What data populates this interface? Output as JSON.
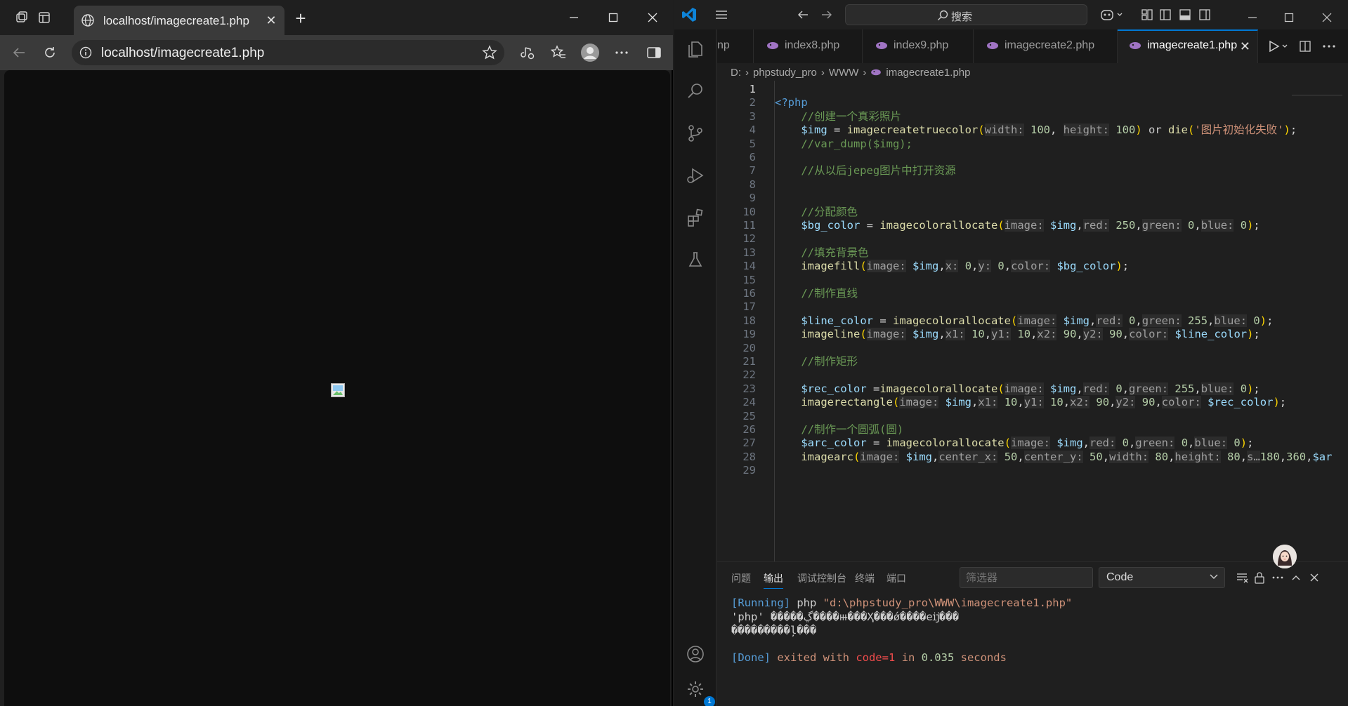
{
  "browser": {
    "tab_title": "localhost/imagecreate1.php",
    "url": "localhost/imagecreate1.php"
  },
  "vscode": {
    "search_label": "搜索",
    "tabs": [
      {
        "label": "np"
      },
      {
        "label": "index8.php"
      },
      {
        "label": "index9.php"
      },
      {
        "label": "imagecreate2.php"
      },
      {
        "label": "imagecreate1.php",
        "active": true
      }
    ],
    "breadcrumb": [
      "D:",
      "phpstudy_pro",
      "WWW",
      "imagecreate1.php"
    ],
    "code_lines": [
      {
        "n": "1",
        "tokens": []
      },
      {
        "n": "2",
        "tokens": [
          [
            "tag",
            "<?php"
          ]
        ]
      },
      {
        "n": "3",
        "tokens": [
          [
            "sp",
            "    "
          ],
          [
            "cm",
            "//创建一个真彩照片"
          ]
        ]
      },
      {
        "n": "4",
        "tokens": [
          [
            "sp",
            "    "
          ],
          [
            "var",
            "$img"
          ],
          [
            "op",
            " = "
          ],
          [
            "fn",
            "imagecreatetruecolor"
          ],
          [
            "par",
            "("
          ],
          [
            "hint",
            "width:"
          ],
          [
            "op",
            " "
          ],
          [
            "num",
            "100"
          ],
          [
            "op",
            ", "
          ],
          [
            "hint",
            "height:"
          ],
          [
            "op",
            " "
          ],
          [
            "num",
            "100"
          ],
          [
            "par",
            ")"
          ],
          [
            "kw",
            " or "
          ],
          [
            "fn",
            "die"
          ],
          [
            "par",
            "("
          ],
          [
            "str",
            "'图片初始化失败'"
          ],
          [
            "par",
            ")"
          ],
          [
            "op",
            ";"
          ]
        ]
      },
      {
        "n": "5",
        "tokens": [
          [
            "sp",
            "    "
          ],
          [
            "cm",
            "//var_dump($img);"
          ]
        ]
      },
      {
        "n": "6",
        "tokens": []
      },
      {
        "n": "7",
        "tokens": [
          [
            "sp",
            "    "
          ],
          [
            "cm",
            "//从以后jepeg图片中打开资源"
          ]
        ]
      },
      {
        "n": "8",
        "tokens": []
      },
      {
        "n": "9",
        "tokens": []
      },
      {
        "n": "10",
        "tokens": [
          [
            "sp",
            "    "
          ],
          [
            "cm",
            "//分配颜色"
          ]
        ]
      },
      {
        "n": "11",
        "tokens": [
          [
            "sp",
            "    "
          ],
          [
            "var",
            "$bg_color"
          ],
          [
            "op",
            " = "
          ],
          [
            "fn",
            "imagecolorallocate"
          ],
          [
            "par",
            "("
          ],
          [
            "hint",
            "image:"
          ],
          [
            "op",
            " "
          ],
          [
            "var",
            "$img"
          ],
          [
            "op",
            ","
          ],
          [
            "hint",
            "red:"
          ],
          [
            "op",
            " "
          ],
          [
            "num",
            "250"
          ],
          [
            "op",
            ","
          ],
          [
            "hint",
            "green:"
          ],
          [
            "op",
            " "
          ],
          [
            "num",
            "0"
          ],
          [
            "op",
            ","
          ],
          [
            "hint",
            "blue:"
          ],
          [
            "op",
            " "
          ],
          [
            "num",
            "0"
          ],
          [
            "par",
            ")"
          ],
          [
            "op",
            ";"
          ]
        ]
      },
      {
        "n": "12",
        "tokens": []
      },
      {
        "n": "13",
        "tokens": [
          [
            "sp",
            "    "
          ],
          [
            "cm",
            "//填充背景色"
          ]
        ]
      },
      {
        "n": "14",
        "tokens": [
          [
            "sp",
            "    "
          ],
          [
            "fn",
            "imagefill"
          ],
          [
            "par",
            "("
          ],
          [
            "hint",
            "image:"
          ],
          [
            "op",
            " "
          ],
          [
            "var",
            "$img"
          ],
          [
            "op",
            ","
          ],
          [
            "hint",
            "x:"
          ],
          [
            "op",
            " "
          ],
          [
            "num",
            "0"
          ],
          [
            "op",
            ","
          ],
          [
            "hint",
            "y:"
          ],
          [
            "op",
            " "
          ],
          [
            "num",
            "0"
          ],
          [
            "op",
            ","
          ],
          [
            "hint",
            "color:"
          ],
          [
            "op",
            " "
          ],
          [
            "var",
            "$bg_color"
          ],
          [
            "par",
            ")"
          ],
          [
            "op",
            ";"
          ]
        ]
      },
      {
        "n": "15",
        "tokens": []
      },
      {
        "n": "16",
        "tokens": [
          [
            "sp",
            "    "
          ],
          [
            "cm",
            "//制作直线"
          ]
        ]
      },
      {
        "n": "17",
        "tokens": []
      },
      {
        "n": "18",
        "tokens": [
          [
            "sp",
            "    "
          ],
          [
            "var",
            "$line_color"
          ],
          [
            "op",
            " = "
          ],
          [
            "fn",
            "imagecolorallocate"
          ],
          [
            "par",
            "("
          ],
          [
            "hint",
            "image:"
          ],
          [
            "op",
            " "
          ],
          [
            "var",
            "$img"
          ],
          [
            "op",
            ","
          ],
          [
            "hint",
            "red:"
          ],
          [
            "op",
            " "
          ],
          [
            "num",
            "0"
          ],
          [
            "op",
            ","
          ],
          [
            "hint",
            "green:"
          ],
          [
            "op",
            " "
          ],
          [
            "num",
            "255"
          ],
          [
            "op",
            ","
          ],
          [
            "hint",
            "blue:"
          ],
          [
            "op",
            " "
          ],
          [
            "num",
            "0"
          ],
          [
            "par",
            ")"
          ],
          [
            "op",
            ";"
          ]
        ]
      },
      {
        "n": "19",
        "tokens": [
          [
            "sp",
            "    "
          ],
          [
            "fn",
            "imageline"
          ],
          [
            "par",
            "("
          ],
          [
            "hint",
            "image:"
          ],
          [
            "op",
            " "
          ],
          [
            "var",
            "$img"
          ],
          [
            "op",
            ","
          ],
          [
            "hint",
            "x1:"
          ],
          [
            "op",
            " "
          ],
          [
            "num",
            "10"
          ],
          [
            "op",
            ","
          ],
          [
            "hint",
            "y1:"
          ],
          [
            "op",
            " "
          ],
          [
            "num",
            "10"
          ],
          [
            "op",
            ","
          ],
          [
            "hint",
            "x2:"
          ],
          [
            "op",
            " "
          ],
          [
            "num",
            "90"
          ],
          [
            "op",
            ","
          ],
          [
            "hint",
            "y2:"
          ],
          [
            "op",
            " "
          ],
          [
            "num",
            "90"
          ],
          [
            "op",
            ","
          ],
          [
            "hint",
            "color:"
          ],
          [
            "op",
            " "
          ],
          [
            "var",
            "$line_color"
          ],
          [
            "par",
            ")"
          ],
          [
            "op",
            ";"
          ]
        ]
      },
      {
        "n": "20",
        "tokens": []
      },
      {
        "n": "21",
        "tokens": [
          [
            "sp",
            "    "
          ],
          [
            "cm",
            "//制作矩形"
          ]
        ]
      },
      {
        "n": "22",
        "tokens": []
      },
      {
        "n": "23",
        "tokens": [
          [
            "sp",
            "    "
          ],
          [
            "var",
            "$rec_color"
          ],
          [
            "op",
            " ="
          ],
          [
            "fn",
            "imagecolorallocate"
          ],
          [
            "par",
            "("
          ],
          [
            "hint",
            "image:"
          ],
          [
            "op",
            " "
          ],
          [
            "var",
            "$img"
          ],
          [
            "op",
            ","
          ],
          [
            "hint",
            "red:"
          ],
          [
            "op",
            " "
          ],
          [
            "num",
            "0"
          ],
          [
            "op",
            ","
          ],
          [
            "hint",
            "green:"
          ],
          [
            "op",
            " "
          ],
          [
            "num",
            "255"
          ],
          [
            "op",
            ","
          ],
          [
            "hint",
            "blue:"
          ],
          [
            "op",
            " "
          ],
          [
            "num",
            "0"
          ],
          [
            "par",
            ")"
          ],
          [
            "op",
            ";"
          ]
        ]
      },
      {
        "n": "24",
        "tokens": [
          [
            "sp",
            "    "
          ],
          [
            "fn",
            "imagerectangle"
          ],
          [
            "par",
            "("
          ],
          [
            "hint",
            "image:"
          ],
          [
            "op",
            " "
          ],
          [
            "var",
            "$img"
          ],
          [
            "op",
            ","
          ],
          [
            "hint",
            "x1:"
          ],
          [
            "op",
            " "
          ],
          [
            "num",
            "10"
          ],
          [
            "op",
            ","
          ],
          [
            "hint",
            "y1:"
          ],
          [
            "op",
            " "
          ],
          [
            "num",
            "10"
          ],
          [
            "op",
            ","
          ],
          [
            "hint",
            "x2:"
          ],
          [
            "op",
            " "
          ],
          [
            "num",
            "90"
          ],
          [
            "op",
            ","
          ],
          [
            "hint",
            "y2:"
          ],
          [
            "op",
            " "
          ],
          [
            "num",
            "90"
          ],
          [
            "op",
            ","
          ],
          [
            "hint",
            "color:"
          ],
          [
            "op",
            " "
          ],
          [
            "var",
            "$rec_color"
          ],
          [
            "par",
            ")"
          ],
          [
            "op",
            ";"
          ]
        ]
      },
      {
        "n": "25",
        "tokens": []
      },
      {
        "n": "26",
        "tokens": [
          [
            "sp",
            "    "
          ],
          [
            "cm",
            "//制作一个圆弧(圆)"
          ]
        ]
      },
      {
        "n": "27",
        "tokens": [
          [
            "sp",
            "    "
          ],
          [
            "var",
            "$arc_color"
          ],
          [
            "op",
            " = "
          ],
          [
            "fn",
            "imagecolorallocate"
          ],
          [
            "par",
            "("
          ],
          [
            "hint",
            "image:"
          ],
          [
            "op",
            " "
          ],
          [
            "var",
            "$img"
          ],
          [
            "op",
            ","
          ],
          [
            "hint",
            "red:"
          ],
          [
            "op",
            " "
          ],
          [
            "num",
            "0"
          ],
          [
            "op",
            ","
          ],
          [
            "hint",
            "green:"
          ],
          [
            "op",
            " "
          ],
          [
            "num",
            "0"
          ],
          [
            "op",
            ","
          ],
          [
            "hint",
            "blue:"
          ],
          [
            "op",
            " "
          ],
          [
            "num",
            "0"
          ],
          [
            "par",
            ")"
          ],
          [
            "op",
            ";"
          ]
        ]
      },
      {
        "n": "28",
        "tokens": [
          [
            "sp",
            "    "
          ],
          [
            "fn",
            "imagearc"
          ],
          [
            "par",
            "("
          ],
          [
            "hint",
            "image:"
          ],
          [
            "op",
            " "
          ],
          [
            "var",
            "$img"
          ],
          [
            "op",
            ","
          ],
          [
            "hint",
            "center_x:"
          ],
          [
            "op",
            " "
          ],
          [
            "num",
            "50"
          ],
          [
            "op",
            ","
          ],
          [
            "hint",
            "center_y:"
          ],
          [
            "op",
            " "
          ],
          [
            "num",
            "50"
          ],
          [
            "op",
            ","
          ],
          [
            "hint",
            "width:"
          ],
          [
            "op",
            " "
          ],
          [
            "num",
            "80"
          ],
          [
            "op",
            ","
          ],
          [
            "hint",
            "height:"
          ],
          [
            "op",
            " "
          ],
          [
            "num",
            "80"
          ],
          [
            "op",
            ","
          ],
          [
            "hint",
            "s…"
          ],
          [
            "num",
            "180"
          ],
          [
            "op",
            ","
          ],
          [
            "num",
            "360"
          ],
          [
            "op",
            ","
          ],
          [
            "var",
            "$ar"
          ]
        ]
      },
      {
        "n": "29",
        "tokens": []
      }
    ],
    "panel": {
      "tabs": [
        "问题",
        "输出",
        "调试控制台",
        "终端",
        "端口"
      ],
      "active_tab": "输出",
      "filter_placeholder": "筛选器",
      "channel": "Code",
      "output_lines": [
        [
          [
            "blue",
            "[Running] "
          ],
          [
            "txt",
            "php "
          ],
          [
            "str",
            "\"d:\\phpstudy_pro\\WWW\\imagecreate1.php\""
          ]
        ],
        [
          [
            "txt",
            "'php' �����ڲ����ⲿ���Ҳ���ǿ����еĳ���"
          ]
        ],
        [
          [
            "txt",
            "���������ļ���"
          ]
        ],
        [],
        [
          [
            "blue",
            "[Done] "
          ],
          [
            "str",
            "exited with "
          ],
          [
            "red",
            "code=1"
          ],
          [
            "str",
            " in "
          ],
          [
            "num",
            "0.035"
          ],
          [
            "str",
            " seconds"
          ]
        ]
      ]
    },
    "settings_badge": "1"
  }
}
